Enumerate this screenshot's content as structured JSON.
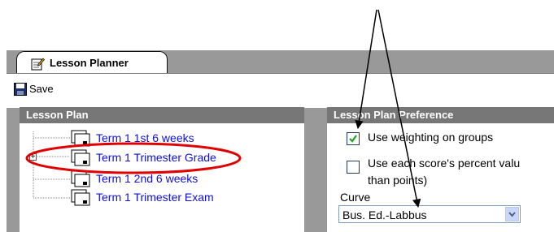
{
  "tab": {
    "label": "Lesson Planner"
  },
  "toolbar": {
    "save_label": "Save"
  },
  "lesson_plan": {
    "header": "Lesson Plan",
    "items": [
      {
        "label": "Term 1 1st 6 weeks"
      },
      {
        "label": "Term 1 Trimester Grade"
      },
      {
        "label": "Term 1 2nd 6 weeks"
      },
      {
        "label": "Term 1 Trimester Exam"
      }
    ]
  },
  "preference": {
    "header": "Lesson Plan Preference",
    "use_weighting_label": "Use weighting on groups",
    "use_weighting_checked": true,
    "use_percent_label_line1": "Use each score's percent valu",
    "use_percent_label_line2": "than points)",
    "use_percent_checked": false,
    "curve_label": "Curve",
    "curve_value": "Bus. Ed.-Labbus"
  },
  "colors": {
    "header_bg": "#777777",
    "frame_bg": "#999999",
    "tree_link": "#1111cc",
    "annotation_red": "#e00000"
  }
}
